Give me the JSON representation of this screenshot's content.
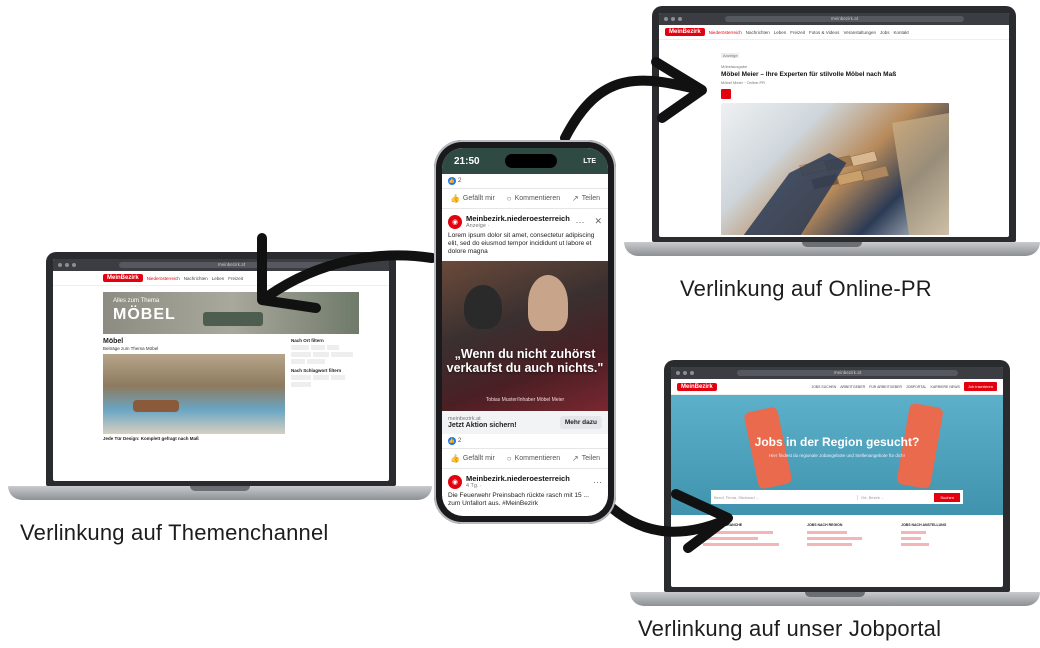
{
  "captions": {
    "online_pr": "Verlinkung auf Online-PR",
    "themenchannel": "Verlinkung auf Themenchannel",
    "jobportal": "Verlinkung auf unser Jobportal"
  },
  "phone": {
    "time": "21:50",
    "status_right": "LTE",
    "top_reaction_count": "2",
    "actions": [
      "Gefällt mir",
      "Kommentieren",
      "Teilen"
    ],
    "post": {
      "page_name": "Meinbezirk.niederoesterreich",
      "subline": "Anzeige · ",
      "text": "Lorem ipsum dolor sit amet, consectetur adipiscing elit, sed do eiusmod tempor incididunt ut labore et dolore magna",
      "quote": "„Wenn du nicht zuhörst verkaufst du auch nichts.\"",
      "credit": "Tobias Muster/Inhaber Möbel Meier",
      "cta_domain": "meinbezirk.at",
      "cta_text": "Jetzt Aktion sichern!",
      "cta_button": "Mehr dazu",
      "reaction_count": "2"
    },
    "post2": {
      "page_name": "Meinbezirk.niederoesterreich",
      "subline": "4 Tg. · ",
      "text": "Die Feuerwehr Preinsbach rückte rasch mit 15 ... zum Unfallort aus. #MeinBezirk"
    }
  },
  "laptop_online_pr": {
    "logo": "MeinBezirk",
    "nav": [
      "Niederösterreich",
      "Nachrichten",
      "Leben",
      "Freizeit",
      "Fotos & Videos",
      "Veranstaltungen",
      "Jobs",
      "Kontakt"
    ],
    "tag": "Anzeige",
    "category": "Möbelausgabe",
    "headline": "Möbel Meier – Ihre Experten für stilvolle Möbel nach Maß",
    "byline": "Möbel Meier · Online-PR"
  },
  "laptop_themen": {
    "logo": "MeinBezirk",
    "nav": [
      "Niederösterreich",
      "Nachrichten",
      "Leben",
      "Freizeit",
      "Fotos & Videos"
    ],
    "banner_small": "Alles zum Thema",
    "banner_big": "MÖBEL",
    "section": "Möbel",
    "subsection": "Beiträge zum Thema Möbel",
    "sidebar_title": "Nach Ort filtern",
    "sidebar_title2": "Nach Schlagwort filtern",
    "article_line": "Jede Tür Design: Komplett gefragt nach Maß"
  },
  "laptop_jobs": {
    "logo": "MeinBezirk",
    "nav": [
      "JOBS SUCHEN",
      "ARBEITGEBER",
      "FÜR ARBEITGEBER",
      "JOBPORTAL",
      "KARRIERE NEWS"
    ],
    "cta": "Job inserieren",
    "hero_title": "Jobs in der Region gesucht?",
    "hero_sub": "Hier findest du regionale Jobangebote und Stellenangebote für dich!",
    "search_placeholder": "Beruf, Firma, Stichwort ...",
    "location_placeholder": "Ort, Bezirk ...",
    "search_button": "Suchen",
    "col_titles": [
      "JOBS NACH BRANCHE",
      "JOBS NACH REGION",
      "JOBS NACH ANSTELLUNG"
    ]
  },
  "colors": {
    "brand_red": "#e3000f",
    "laptop_frame": "#2a2b2e",
    "phone_status": "#2f4a43",
    "jobs_hero": "#4fa3bf"
  }
}
